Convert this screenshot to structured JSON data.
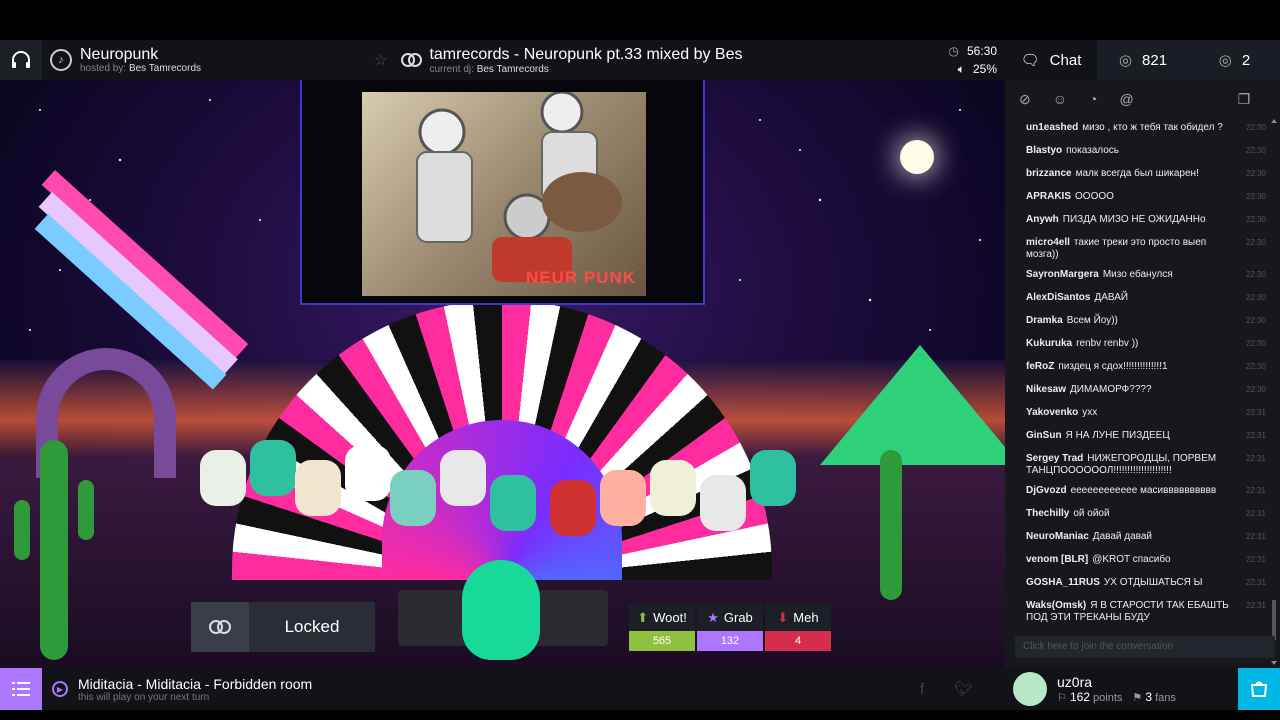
{
  "room": {
    "name": "Neuropunk",
    "hosted_by_label": "hosted by:",
    "host": "Bes Tamrecords"
  },
  "now_playing": {
    "title": "tamrecords - Neuropunk pt.33 mixed by Bes",
    "current_dj_label": "current dj:",
    "dj": "Bes Tamrecords",
    "time_left": "56:30",
    "volume": "25%"
  },
  "artwork": {
    "logo_text": "NEUR PUNK"
  },
  "booth": {
    "locked_label": "Locked"
  },
  "votes": [
    {
      "label": "Woot!",
      "count": "565",
      "color": "#90c040",
      "icon": "arrow-up-icon"
    },
    {
      "label": "Grab",
      "count": "132",
      "color": "#ac76ff",
      "icon": "star-icon"
    },
    {
      "label": "Meh",
      "count": "4",
      "color": "#d42e4c",
      "icon": "arrow-down-icon"
    }
  ],
  "next": {
    "title": "Miditacia - Miditacia - Forbidden room",
    "subtitle": "this will play on your next turn"
  },
  "user": {
    "name": "uz0ra",
    "points": "162",
    "points_label": "points",
    "fans": "3",
    "fans_label": "fans"
  },
  "panel": {
    "chat_tab": "Chat",
    "audience_count": "821",
    "waitlist_count": "2",
    "input_placeholder": "Click here to join the conversation",
    "messages": [
      {
        "from": "un1eashed",
        "text": "мизо , кто ж тебя так обидел ?",
        "time": "22:30"
      },
      {
        "from": "Blastyo",
        "text": "показалось",
        "time": "22:30"
      },
      {
        "from": "brizzance",
        "text": "малк всегда был шикарен!",
        "time": "22:30"
      },
      {
        "from": "APRAKIS",
        "text": "ООООО",
        "time": "22:30"
      },
      {
        "from": "Anywh",
        "text": "ПИЗДА МИЗО НЕ ОЖИДАННо",
        "time": "22:30"
      },
      {
        "from": "micro4ell",
        "text": "такие треки это просто выеп мозга))",
        "time": "22:30"
      },
      {
        "from": "SayronMargera",
        "text": "Мизо ебанулся",
        "time": "22:30"
      },
      {
        "from": "AlexDiSantos",
        "text": "ДАВАЙ",
        "time": "22:30"
      },
      {
        "from": "Dramka",
        "text": "Всем Йоу))",
        "time": "22:30"
      },
      {
        "from": "Kukuruka",
        "text": "renbv renbv ))",
        "time": "22:30"
      },
      {
        "from": "feRoZ",
        "text": "пиздец я сдох!!!!!!!!!!!!!!1",
        "time": "22:30"
      },
      {
        "from": "Nikesaw",
        "text": "ДИМАМОРФ????",
        "time": "22:30"
      },
      {
        "from": "Yakovenko",
        "text": "ухх",
        "time": "22:31"
      },
      {
        "from": "GinSun",
        "text": "Я НА ЛУНЕ ПИЗДЕЕЦ",
        "time": "22:31"
      },
      {
        "from": "Sergey Trad",
        "text": "НИЖЕГОРОДЦЫ, ПОРВЕМ ТАНЦПООООООЛ!!!!!!!!!!!!!!!!!!!!!",
        "time": "22:31"
      },
      {
        "from": "DjGvozd",
        "text": "ееееееееееее масивввввввввв",
        "time": "22:31"
      },
      {
        "from": "Thechilly",
        "text": "ой ойой",
        "time": "22:31"
      },
      {
        "from": "NeuroManiac",
        "text": "Давай давай",
        "time": "22:31"
      },
      {
        "from": "venom [BLR]",
        "text": "@KROT спасибо",
        "time": "22:31"
      },
      {
        "from": "GOSHA_11RUS",
        "text": "УХ ОТДЫШАТЬСЯ Ы",
        "time": "22:31"
      },
      {
        "from": "Waks(Omsk)",
        "text": "Я В СТАРОСТИ ТАК ЕБАШТЬ ПОД ЭТИ ТРЕКАНЫ БУДУ",
        "time": "22:31"
      }
    ]
  }
}
